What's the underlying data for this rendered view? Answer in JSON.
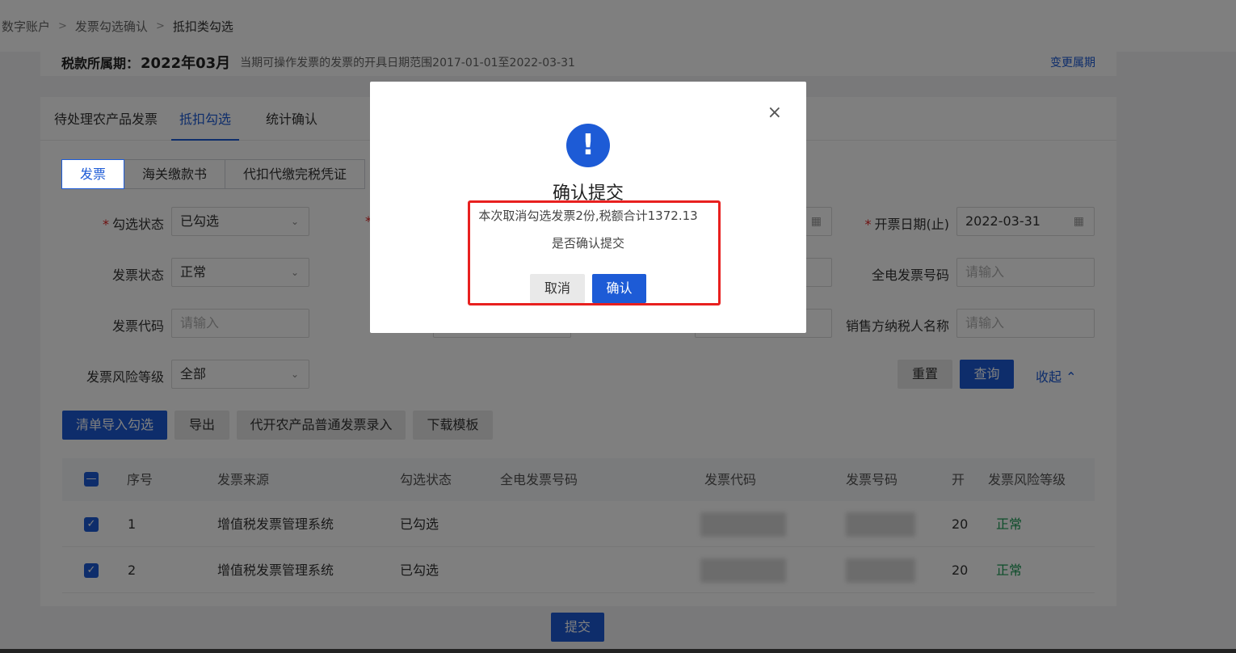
{
  "breadcrumb": {
    "items": [
      "数字账户",
      "发票勾选确认",
      "抵扣类勾选"
    ]
  },
  "period": {
    "label": "税款所属期：",
    "value": "2022年03月",
    "note": "当期可操作发票的发票的开具日期范围2017-01-01至2022-03-31",
    "change_link": "变更属期"
  },
  "tabs": [
    {
      "label": "待处理农产品发票"
    },
    {
      "label": "抵扣勾选"
    },
    {
      "label": "统计确认"
    }
  ],
  "subtabs": [
    {
      "label": "发票"
    },
    {
      "label": "海关缴款书"
    },
    {
      "label": "代扣代缴完税凭证"
    }
  ],
  "filters": {
    "select_status": {
      "label": "勾选状态",
      "value": "已勾选"
    },
    "invoice_status": {
      "label": "发票状态",
      "value": "正常"
    },
    "invoice_code": {
      "label": "发票代码",
      "placeholder": "请输入"
    },
    "risk_level": {
      "label": "发票风险等级",
      "value": "全部"
    },
    "date_end": {
      "label": "开票日期(止)",
      "value": "2022-03-31"
    },
    "einvoice_no": {
      "label": "全电发票号码",
      "placeholder": "请输入"
    },
    "seller_name": {
      "label": "销售方纳税人名称",
      "placeholder": "请输入"
    },
    "required_mark": "*"
  },
  "filter_actions": {
    "reset": "重置",
    "query": "查询",
    "collapse": "收起"
  },
  "toolbar": {
    "import": "清单导入勾选",
    "export": "导出",
    "agri_entry": "代开农产品普通发票录入",
    "download_template": "下载模板"
  },
  "table": {
    "headers": [
      "序号",
      "发票来源",
      "勾选状态",
      "全电发票号码",
      "发票代码",
      "发票号码",
      "开",
      "发票风险等级"
    ],
    "rows": [
      {
        "index": "1",
        "source": "增值税发票管理系统",
        "status": "已勾选",
        "date_prefix": "20",
        "risk": "正常"
      },
      {
        "index": "2",
        "source": "增值税发票管理系统",
        "status": "已勾选",
        "date_prefix": "20",
        "risk": "正常"
      }
    ]
  },
  "submit_label": "提交",
  "modal": {
    "icon": "!",
    "title": "确认提交",
    "line1": "本次取消勾选发票2份,税额合计1372.13",
    "line2": "是否确认提交",
    "cancel": "取消",
    "ok": "确认",
    "close": "×"
  },
  "colors": {
    "primary": "#1d5bd6",
    "danger": "#e8201f",
    "success": "#1a9a55"
  }
}
